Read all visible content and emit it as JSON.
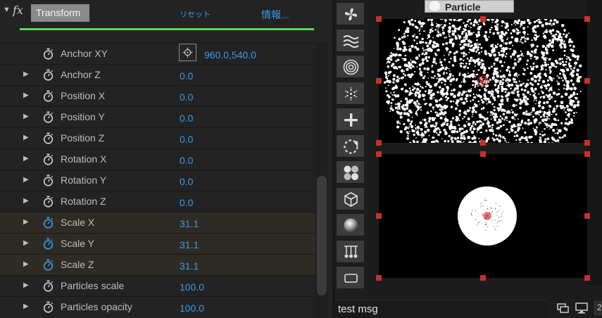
{
  "effect": {
    "name": "Transform",
    "reset_label": "リセット",
    "about_label": "情報...",
    "fx_badge": "fx",
    "twirl_icon": "triangle-down-icon"
  },
  "properties": [
    {
      "id": "anchor-xy",
      "label": "Anchor XY",
      "value": "960.0,540.0",
      "twirl": false,
      "keyframed": false,
      "point": true
    },
    {
      "id": "anchor-z",
      "label": "Anchor Z",
      "value": "0.0",
      "twirl": true,
      "keyframed": false
    },
    {
      "id": "position-x",
      "label": "Position X",
      "value": "0.0",
      "twirl": true,
      "keyframed": false
    },
    {
      "id": "position-y",
      "label": "Position Y",
      "value": "0.0",
      "twirl": true,
      "keyframed": false
    },
    {
      "id": "position-z",
      "label": "Position Z",
      "value": "0.0",
      "twirl": true,
      "keyframed": false
    },
    {
      "id": "rotation-x",
      "label": "Rotation X",
      "value": "0.0",
      "twirl": true,
      "keyframed": false
    },
    {
      "id": "rotation-y",
      "label": "Rotation Y",
      "value": "0.0",
      "twirl": true,
      "keyframed": false
    },
    {
      "id": "rotation-z",
      "label": "Rotation Z",
      "value": "0.0",
      "twirl": true,
      "keyframed": false
    },
    {
      "id": "scale-x",
      "label": "Scale X",
      "value": "31.1",
      "twirl": true,
      "keyframed": true
    },
    {
      "id": "scale-y",
      "label": "Scale Y",
      "value": "31.1",
      "twirl": true,
      "keyframed": true
    },
    {
      "id": "scale-z",
      "label": "Scale Z",
      "value": "31.1",
      "twirl": true,
      "keyframed": true
    },
    {
      "id": "particles-scale",
      "label": "Particles scale",
      "value": "100.0",
      "twirl": true,
      "keyframed": false
    },
    {
      "id": "particles-opacity",
      "label": "Particles opacity",
      "value": "100.0",
      "twirl": true,
      "keyframed": false
    }
  ],
  "toolbar": {
    "buttons": [
      {
        "name": "fan-icon"
      },
      {
        "name": "waves-icon"
      },
      {
        "name": "concentric-rings-icon"
      },
      {
        "name": "snowflake-icon"
      },
      {
        "name": "plus-icon"
      },
      {
        "name": "dashed-circle-icon"
      },
      {
        "name": "four-circles-icon"
      },
      {
        "name": "cube-icon"
      },
      {
        "name": "sphere-icon"
      },
      {
        "name": "emitter-array-icon"
      },
      {
        "name": "rectangle-icon"
      }
    ]
  },
  "viewer": {
    "tab_label": "Particle",
    "status_message": "test msg",
    "bottom_number": "2",
    "colors": {
      "accent": "#3b9ae6",
      "handle": "#c8312b",
      "green_line": "#56d95b"
    }
  }
}
